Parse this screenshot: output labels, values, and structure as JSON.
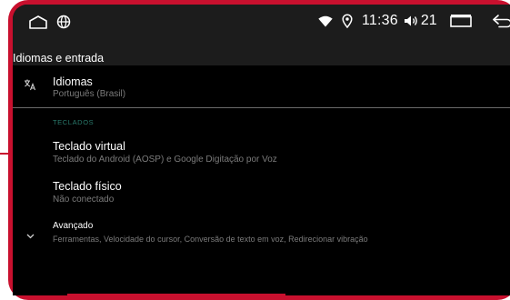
{
  "status_bar": {
    "time": "11:36",
    "volume": "21",
    "icons": [
      "home-icon",
      "globe-icon",
      "wifi-icon",
      "location-icon",
      "volume-icon",
      "recents-icon",
      "back-icon"
    ]
  },
  "header": {
    "title": "Idiomas e entrada"
  },
  "languages": {
    "title": "Idiomas",
    "subtitle": "Português (Brasil)",
    "icon": "translate-icon"
  },
  "section_header": "TECLADOS",
  "virtual_keyboard": {
    "title": "Teclado virtual",
    "subtitle": "Teclado do Android (AOSP) e Google Digitação por Voz"
  },
  "physical_keyboard": {
    "title": "Teclado físico",
    "subtitle": "Não conectado"
  },
  "advanced": {
    "title": "Avançado",
    "subtitle": "Ferramentas, Velocidade do cursor, Conversão de texto em voz, Redirecionar vibração",
    "icon": "chevron-down-icon"
  },
  "colors": {
    "frame": "#c8102e",
    "accent": "#2a7a6c",
    "background": "#000000",
    "bar": "#1c1c1c"
  }
}
